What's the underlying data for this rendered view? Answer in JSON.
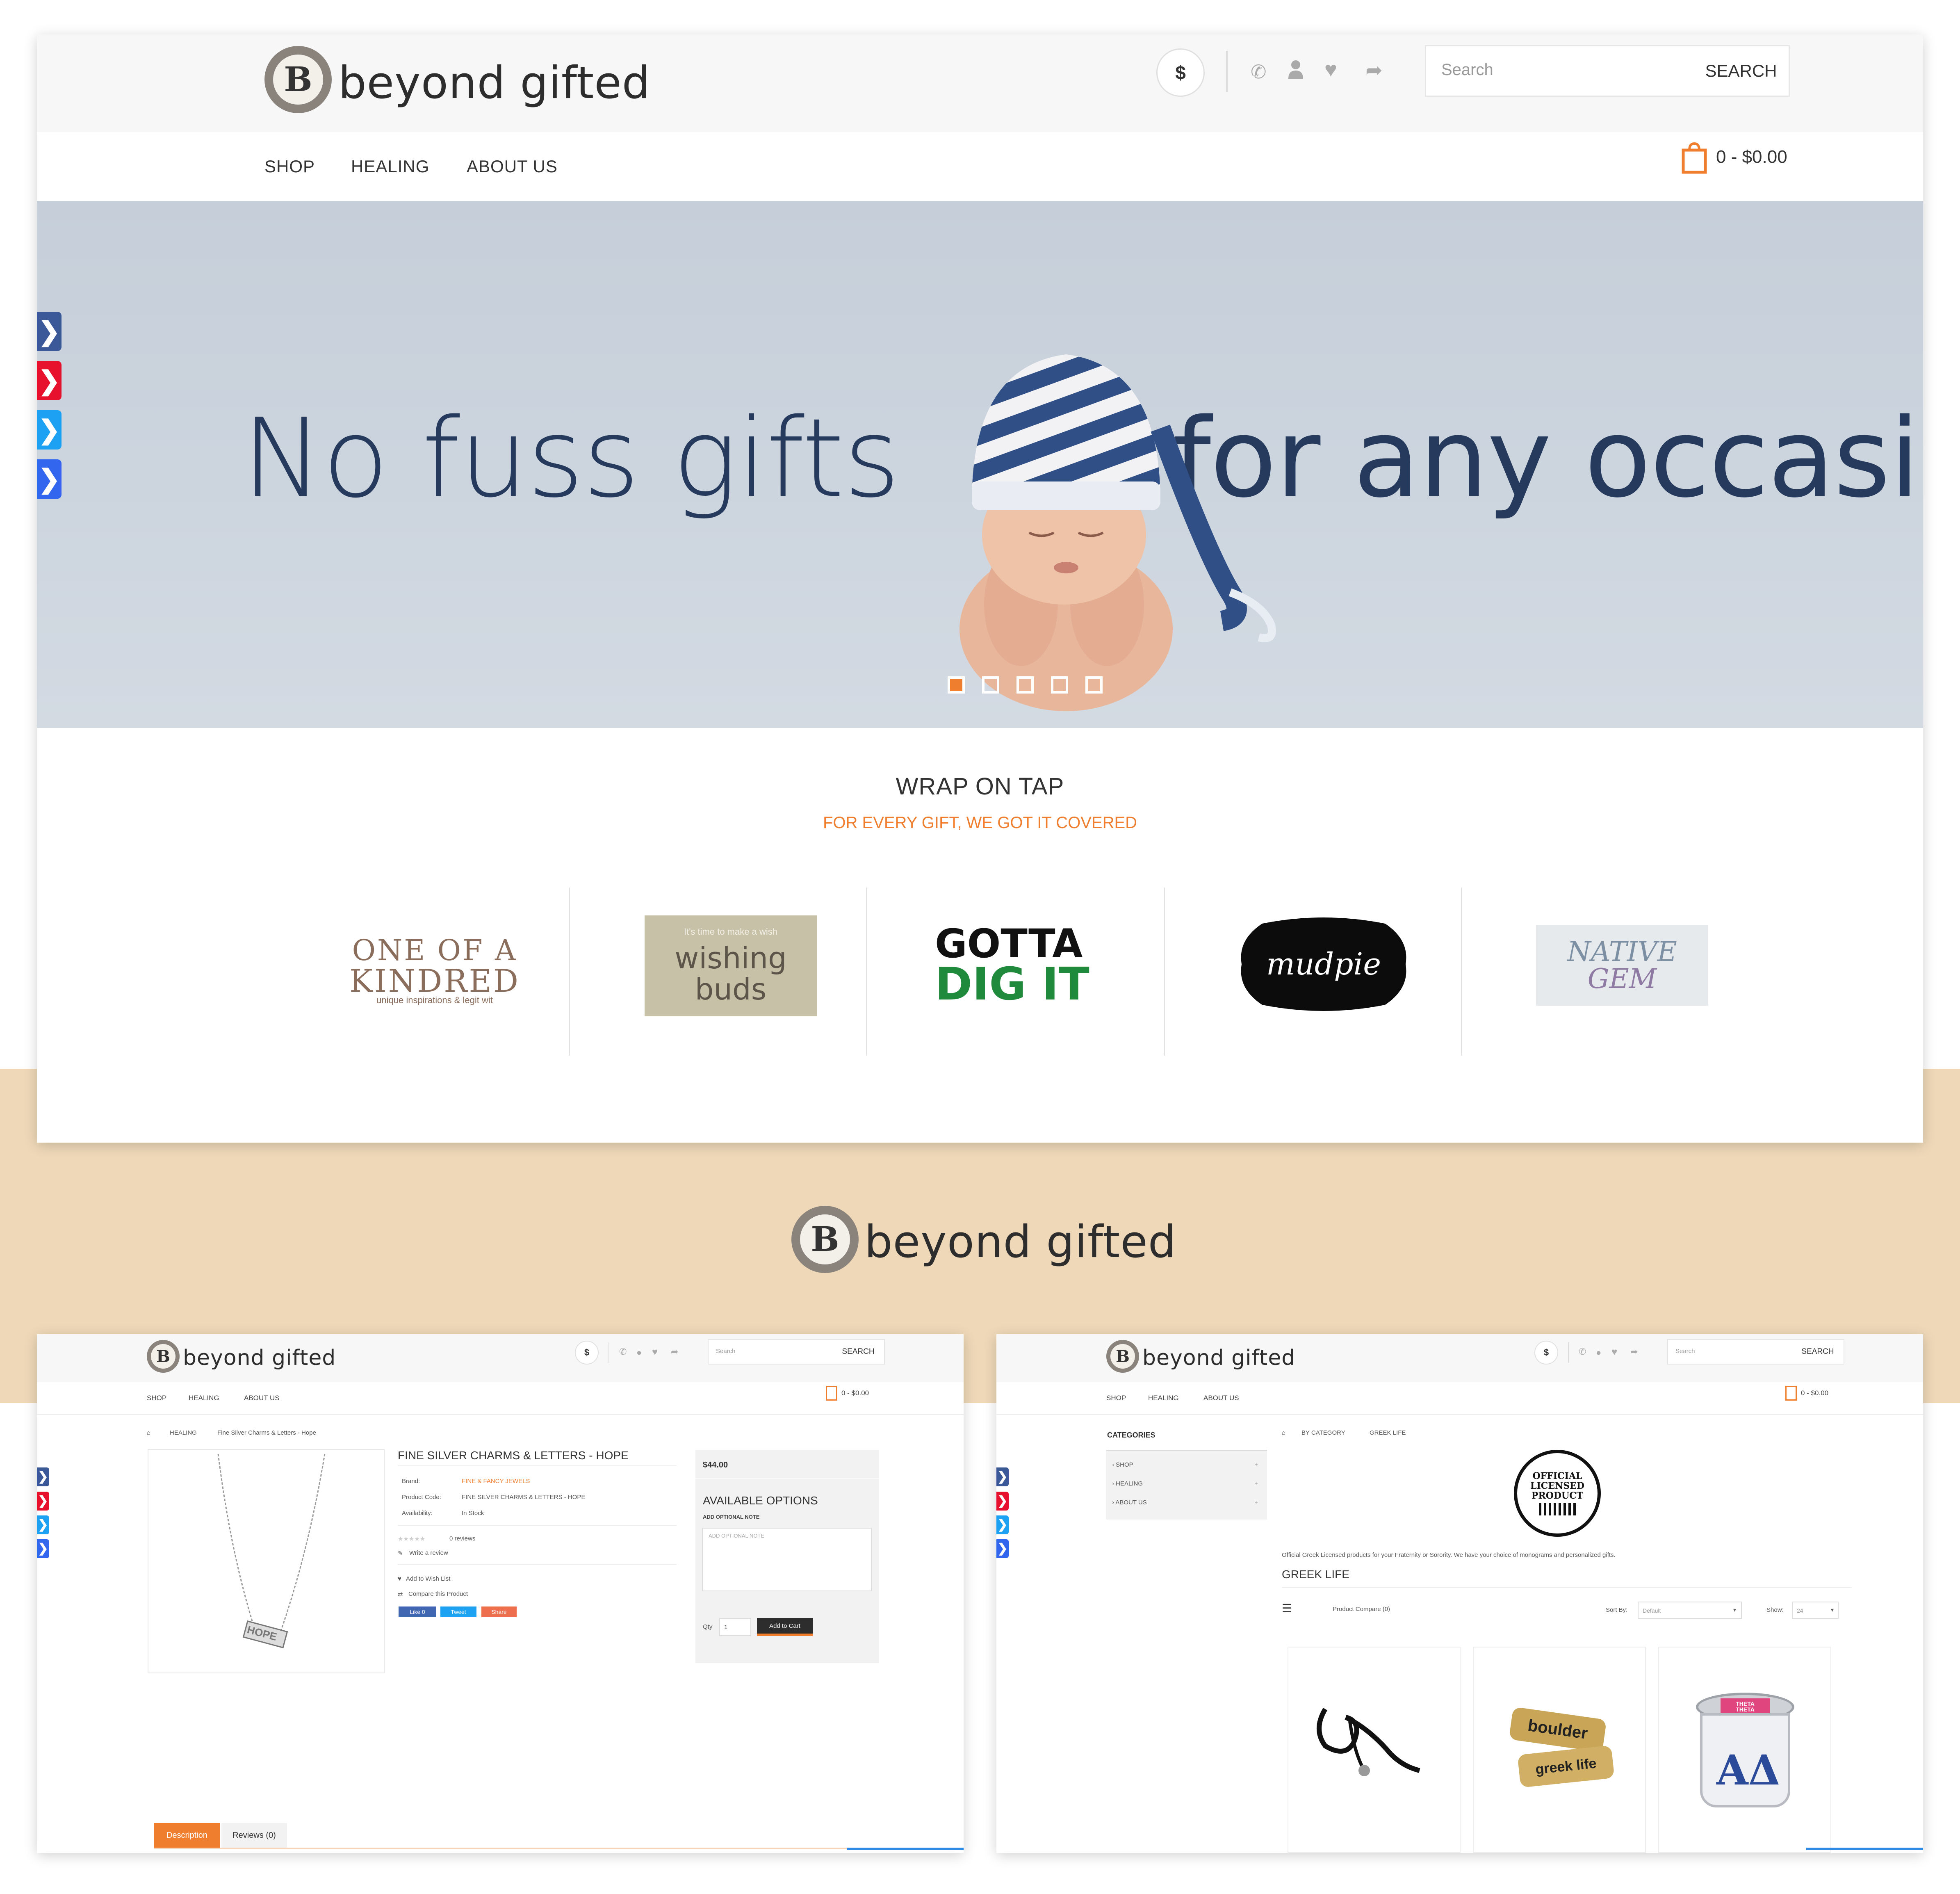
{
  "brand": {
    "logo_letter": "B",
    "logo_text": "beyond gifted"
  },
  "header": {
    "currency_symbol": "$",
    "search_placeholder": "Search",
    "search_button": "SEARCH",
    "cart_text": "0 - $0.00"
  },
  "nav": {
    "items": [
      "SHOP",
      "HEALING",
      "ABOUT US"
    ]
  },
  "hero": {
    "left_text": "No fuss gifts",
    "right_text": "for any occasion",
    "slides": 5,
    "active_slide": 1
  },
  "section": {
    "title": "WRAP ON TAP",
    "subtitle": "FOR EVERY GIFT, WE GOT IT COVERED"
  },
  "brands": [
    {
      "line1": "ONE OF A",
      "line2": "KINDRED",
      "tag": "unique inspirations & legit wit"
    },
    {
      "top": "It's time to make a wish",
      "line1": "wishing",
      "line2": "buds"
    },
    {
      "line1": "GOTTA",
      "line2": "DIG IT"
    },
    {
      "line1": "mudpie"
    },
    {
      "line1": "NATIVE",
      "line2": "GEM"
    }
  ],
  "colors": {
    "accent": "#ef7e2f",
    "beige": "#eed8b8",
    "hero_bg": "#c9d2dc",
    "text_blue": "#253a5c"
  },
  "product_page": {
    "breadcrumb": [
      "HEALING",
      "Fine Silver Charms & Letters - Hope"
    ],
    "title": "FINE SILVER CHARMS & LETTERS - HOPE",
    "brand_label": "Brand:",
    "brand_value": "FINE & FANCY JEWELS",
    "code_label": "Product Code:",
    "code_value": "FINE SILVER CHARMS & LETTERS - HOPE",
    "avail_label": "Availability:",
    "avail_value": "In Stock",
    "reviews": "0 reviews",
    "write_review": "Write a review",
    "wishlist": "Add to Wish List",
    "compare": "Compare this Product",
    "social": [
      "Like 0",
      "Tweet",
      "Share"
    ],
    "price": "$44.00",
    "options_title": "AVAILABLE OPTIONS",
    "note_label": "ADD OPTIONAL NOTE",
    "note_placeholder": "ADD OPTIONAL NOTE",
    "qty_label": "Qty",
    "qty_value": "1",
    "add_to_cart": "Add to Cart",
    "tabs": [
      "Description",
      "Reviews (0)"
    ],
    "charm_text": "HOPE"
  },
  "category_page": {
    "categories_title": "CATEGORIES",
    "categories": [
      "SHOP",
      "HEALING",
      "ABOUT US"
    ],
    "breadcrumb": [
      "BY CATEGORY",
      "GREEK LIFE"
    ],
    "badge": [
      "OFFICIAL",
      "LICENSED",
      "PRODUCT"
    ],
    "description": "Official Greek Licensed products for your Fraternity or Sorority. We have your choice of monograms and personalized gifts.",
    "heading": "GREEK LIFE",
    "compare": "Product Compare (0)",
    "sort_label": "Sort By:",
    "sort_value": "Default",
    "show_label": "Show:",
    "show_value": "24",
    "products": [
      {
        "label": ""
      },
      {
        "label1": "boulder",
        "label2": "greek life"
      },
      {
        "label1": "THETA",
        "label2": "THETA"
      }
    ]
  }
}
